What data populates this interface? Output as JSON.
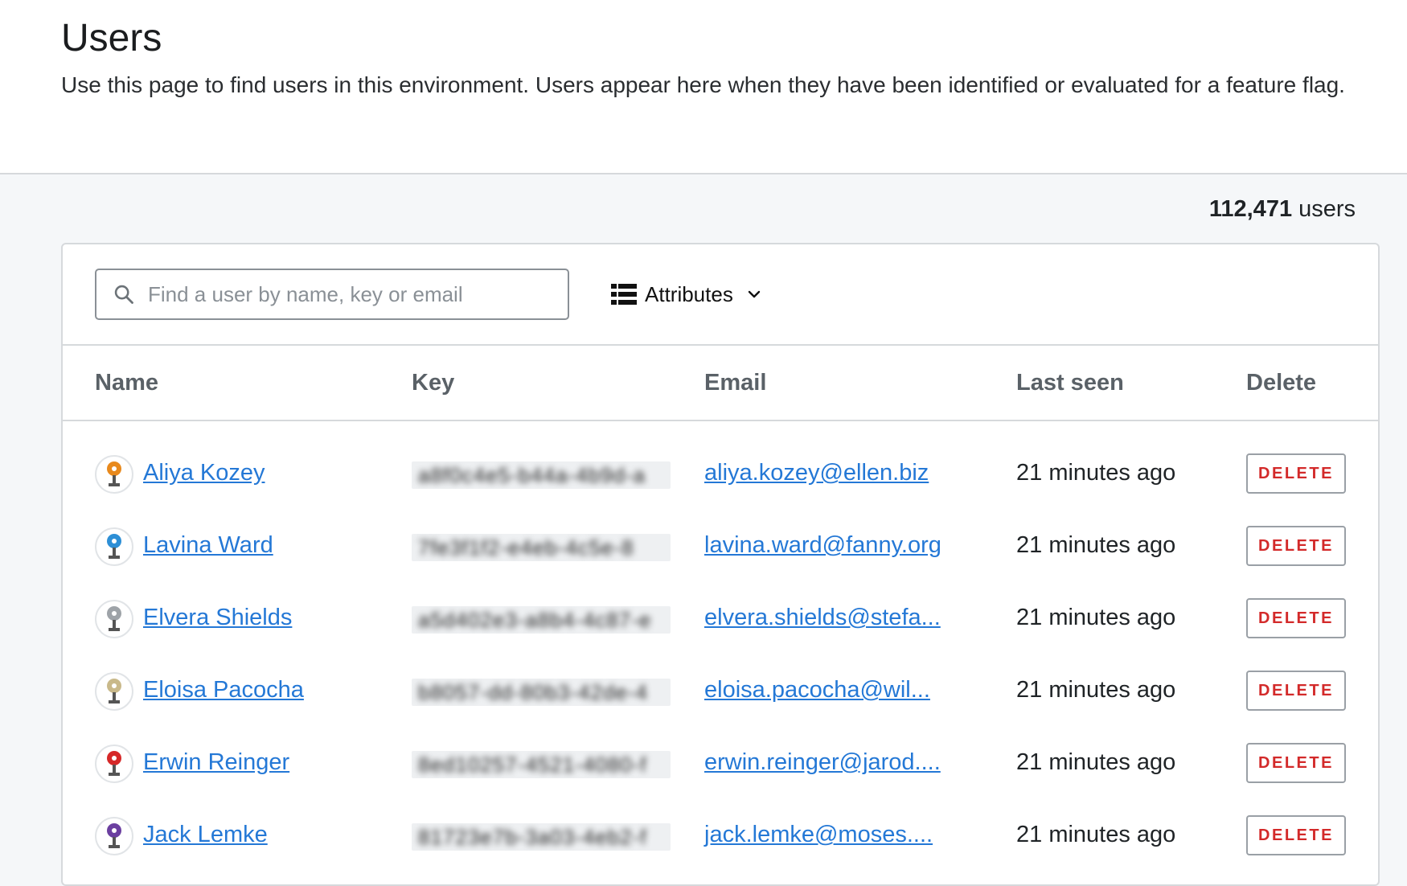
{
  "header": {
    "title": "Users",
    "description": "Use this page to find users in this environment. Users appear here when they have been identified or evaluated for a feature flag."
  },
  "summary": {
    "count": "112,471",
    "count_suffix": "users"
  },
  "toolbar": {
    "search_placeholder": "Find a user by name, key or email",
    "attributes_label": "Attributes"
  },
  "table": {
    "columns": [
      "Name",
      "Key",
      "Email",
      "Last seen",
      "Delete"
    ],
    "rows": [
      {
        "name": "Aliya Kozey",
        "key": "a8f0c4e5-b44a-4b9d-a",
        "email": "aliya.kozey@ellen.biz",
        "last_seen": "21 minutes ago",
        "delete_label": "DELETE",
        "avatar_color": "#e8891c"
      },
      {
        "name": "Lavina Ward",
        "key": "7fe3f1f2-e4eb-4c5e-8",
        "email": "lavina.ward@fanny.org",
        "last_seen": "21 minutes ago",
        "delete_label": "DELETE",
        "avatar_color": "#2d8fd6"
      },
      {
        "name": "Elvera Shields",
        "key": "a5d402e3-a8b4-4c87-e",
        "email": "elvera.shields@stefa...",
        "last_seen": "21 minutes ago",
        "delete_label": "DELETE",
        "avatar_color": "#9ea3a8"
      },
      {
        "name": "Eloisa Pacocha",
        "key": "b8057-dd-80b3-42de-4",
        "email": "eloisa.pacocha@wil...",
        "last_seen": "21 minutes ago",
        "delete_label": "DELETE",
        "avatar_color": "#c9b98a"
      },
      {
        "name": "Erwin Reinger",
        "key": "8ed10257-4521-4080-f",
        "email": "erwin.reinger@jarod....",
        "last_seen": "21 minutes ago",
        "delete_label": "DELETE",
        "avatar_color": "#d62828"
      },
      {
        "name": "Jack Lemke",
        "key": "81723e7b-3a03-4eb2-f",
        "email": "jack.lemke@moses....",
        "last_seen": "21 minutes ago",
        "delete_label": "DELETE",
        "avatar_color": "#6b3fa0"
      }
    ]
  }
}
